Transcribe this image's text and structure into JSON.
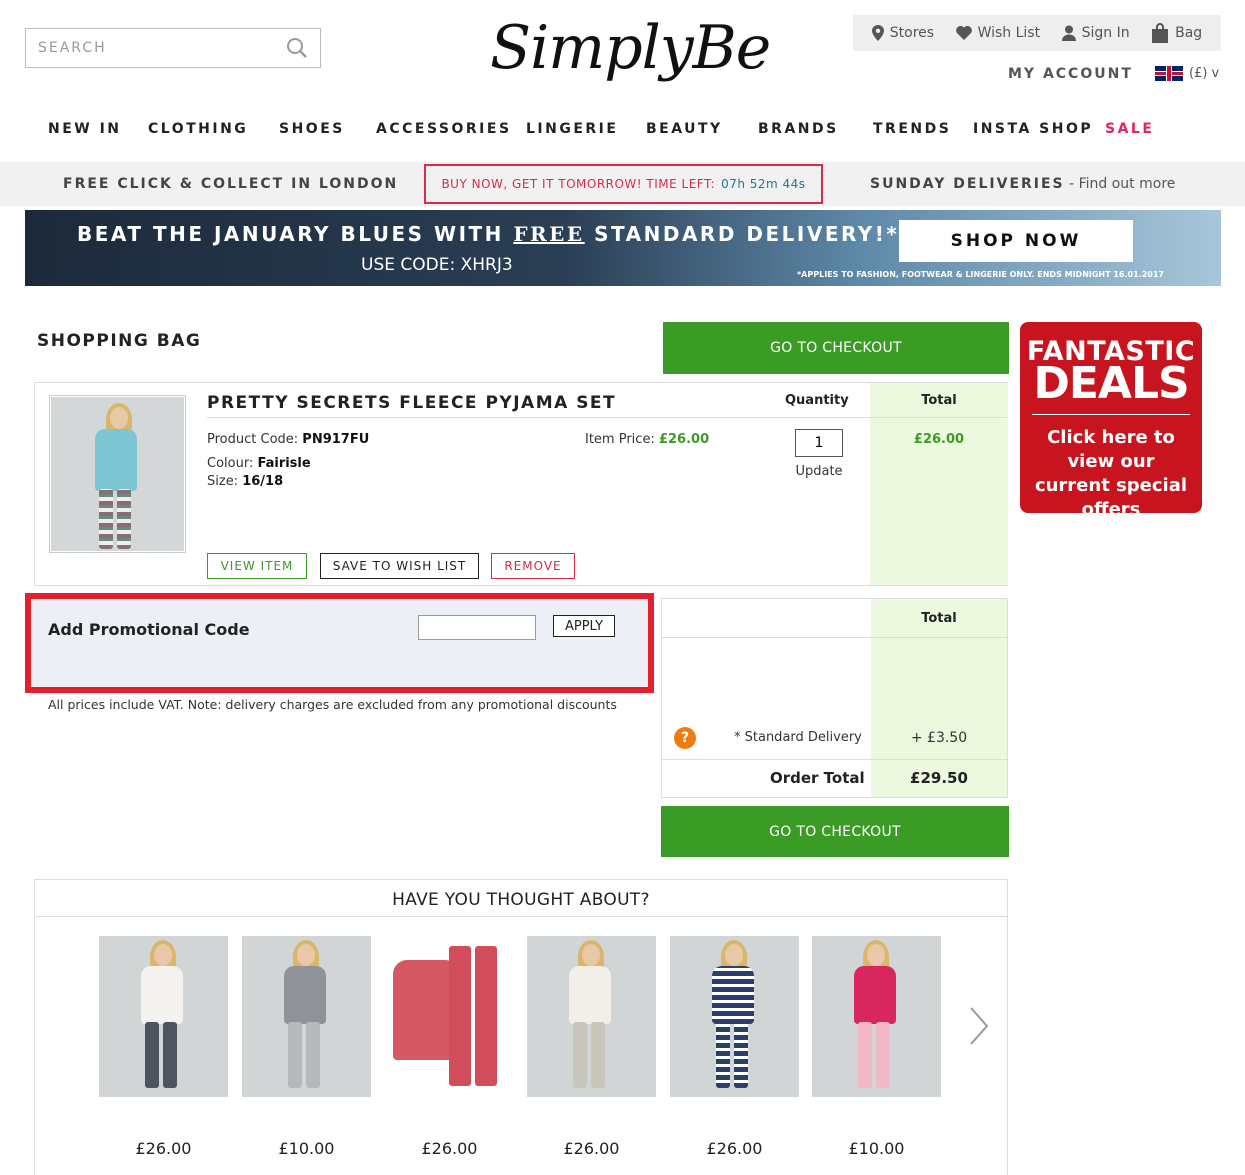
{
  "header": {
    "search_placeholder": "SEARCH",
    "logo": "SimplyBe",
    "util": {
      "stores": "Stores",
      "wishlist": "Wish List",
      "signin": "Sign In",
      "bag": "Bag"
    },
    "my_account": "MY ACCOUNT",
    "currency": "(£) v"
  },
  "nav": {
    "items": [
      "NEW IN",
      "CLOTHING",
      "SHOES",
      "ACCESSORIES",
      "LINGERIE",
      "BEAUTY",
      "BRANDS",
      "TRENDS",
      "INSTA SHOP",
      "SALE"
    ]
  },
  "strip": {
    "click_collect": "FREE CLICK & COLLECT IN LONDON",
    "timer_text": "BUY NOW, GET IT TOMORROW! TIME LEFT:",
    "timer_value": "07h 52m 44s",
    "sunday": "SUNDAY DELIVERIES",
    "sunday_more": " - Find out more"
  },
  "banner": {
    "head_pre": "BEAT THE JANUARY BLUES WITH ",
    "head_free": "FREE",
    "head_post": " STANDARD DELIVERY!*",
    "code": "USE CODE: XHRJ3",
    "button": "SHOP NOW",
    "fine": "*APPLIES TO FASHION, FOOTWEAR & LINGERIE ONLY. ENDS MIDNIGHT 16.01.2017"
  },
  "bag": {
    "title": "SHOPPING BAG",
    "checkout_label": "GO TO CHECKOUT",
    "item": {
      "name": "PRETTY SECRETS FLEECE PYJAMA SET",
      "quantity_header": "Quantity",
      "total_header": "Total",
      "code_label": "Product Code: ",
      "code": "PN917FU",
      "colour_label": "Colour: ",
      "colour": "Fairisle",
      "size_label": "Size: ",
      "size": "16/18",
      "item_price_label": "Item Price: ",
      "item_price": "£26.00",
      "quantity": "1",
      "update": "Update",
      "line_total": "£26.00",
      "view_item": "VIEW ITEM",
      "save_wish": "SAVE TO WISH LIST",
      "remove": "REMOVE"
    },
    "promo": {
      "label": "Add Promotional Code",
      "apply": "APPLY",
      "value": ""
    },
    "vat_note": "All prices include VAT. Note: delivery charges are excluded from any promotional discounts",
    "summary": {
      "total_header": "Total",
      "help": "?",
      "delivery_label": "* Standard Delivery",
      "delivery_value": "+ £3.50",
      "order_total_label": "Order Total",
      "order_total_value": "£29.50"
    }
  },
  "deals": {
    "line1": "FANTASTIC",
    "line2": "DEALS",
    "line3": "Click here to view our current special offers"
  },
  "recommendations": {
    "title": "HAVE YOU THOUGHT ABOUT?",
    "items": [
      {
        "price": "£26.00"
      },
      {
        "price": "£10.00"
      },
      {
        "price": "£26.00"
      },
      {
        "price": "£26.00"
      },
      {
        "price": "£26.00"
      },
      {
        "price": "£10.00"
      }
    ]
  },
  "colors": {
    "green": "#3a9b25",
    "red": "#e2212d",
    "sale_pink": "#e0246c",
    "light_green_bg": "#ecf9df",
    "orange": "#f07b0e"
  }
}
